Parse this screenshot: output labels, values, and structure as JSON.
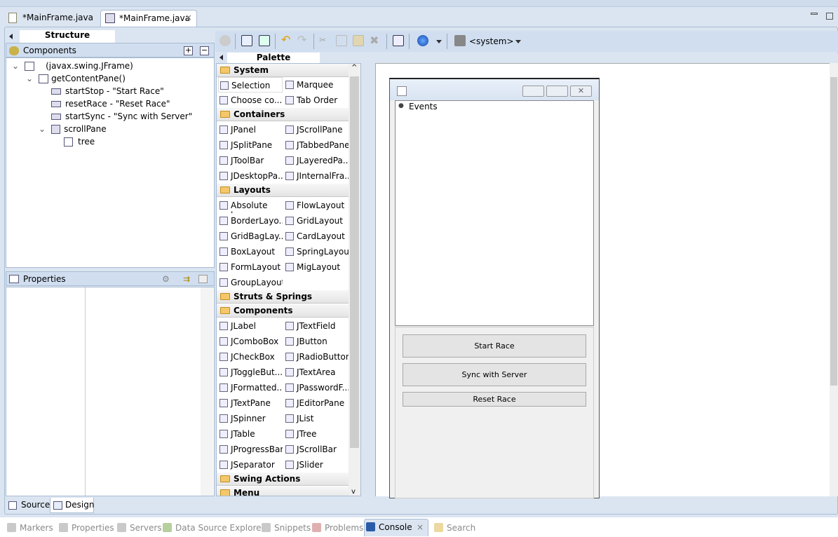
{
  "editor_tabs": [
    {
      "label": "*MainFrame.java",
      "active": false
    },
    {
      "label": "*MainFrame.java",
      "active": true,
      "close": "×"
    }
  ],
  "structure": {
    "title": "Structure",
    "components_title": "Components",
    "tree": [
      {
        "label": "(javax.swing.JFrame)",
        "level": 0,
        "expanded": true
      },
      {
        "label": "getContentPane()",
        "level": 1,
        "expanded": true
      },
      {
        "label": "startStop - \"Start Race\"",
        "level": 2
      },
      {
        "label": "resetRace - \"Reset Race\"",
        "level": 2
      },
      {
        "label": "startSync - \"Sync with Server\"",
        "level": 2
      },
      {
        "label": "scrollPane",
        "level": 2,
        "expanded": true
      },
      {
        "label": "tree",
        "level": 3
      }
    ]
  },
  "properties": {
    "title": "Properties"
  },
  "toolbar": {
    "system_label": "<system>"
  },
  "palette": {
    "title": "Palette",
    "categories": [
      {
        "name": "System",
        "items": [
          "Selection",
          "Marquee",
          "Choose co...",
          "Tab Order"
        ]
      },
      {
        "name": "Containers",
        "items": [
          "JPanel",
          "JScrollPane",
          "JSplitPane",
          "JTabbedPane",
          "JToolBar",
          "JLayeredPa...",
          "JDesktopPa...",
          "JInternalFra..."
        ]
      },
      {
        "name": "Layouts",
        "items": [
          "Absolute la...",
          "FlowLayout",
          "BorderLayo...",
          "GridLayout",
          "GridBagLay...",
          "CardLayout",
          "BoxLayout",
          "SpringLayout",
          "FormLayout",
          "MigLayout",
          "GroupLayout"
        ]
      },
      {
        "name": "Struts & Springs",
        "items": []
      },
      {
        "name": "Components",
        "items": [
          "JLabel",
          "JTextField",
          "JComboBox",
          "JButton",
          "JCheckBox",
          "JRadioButton",
          "JToggleBut...",
          "JTextArea",
          "JFormatted...",
          "JPasswordF...",
          "JTextPane",
          "JEditorPane",
          "JSpinner",
          "JList",
          "JTable",
          "JTree",
          "JProgressBar",
          "JScrollBar",
          "JSeparator",
          "JSlider"
        ]
      },
      {
        "name": "Swing Actions",
        "items": []
      },
      {
        "name": "Menu",
        "items": []
      }
    ],
    "selected": "Selection"
  },
  "design": {
    "tree_root": "Events",
    "buttons": [
      "Start Race",
      "Sync with Server",
      "Reset Race"
    ]
  },
  "mode_tabs": [
    {
      "label": "Source"
    },
    {
      "label": "Design",
      "active": true
    }
  ],
  "bottom_tabs": [
    {
      "label": "Markers"
    },
    {
      "label": "Properties"
    },
    {
      "label": "Servers"
    },
    {
      "label": "Data Source Explorer"
    },
    {
      "label": "Snippets"
    },
    {
      "label": "Problems"
    },
    {
      "label": "Console",
      "active": true,
      "close": "×"
    },
    {
      "label": "Search"
    }
  ]
}
